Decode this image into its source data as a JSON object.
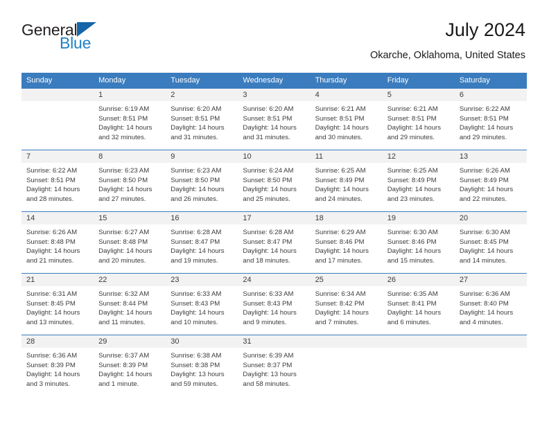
{
  "brand": {
    "name_part1": "General",
    "name_part2": "Blue",
    "triangle_color": "#1565a8",
    "blue_color": "#2081c6"
  },
  "header": {
    "title": "July 2024",
    "location": "Okarche, Oklahoma, United States"
  },
  "theme": {
    "header_row_bg": "#3a7cbe",
    "daynum_bg": "#f2f2f2",
    "text_color": "#3b3b3b",
    "page_bg": "#ffffff"
  },
  "weekdays": [
    "Sunday",
    "Monday",
    "Tuesday",
    "Wednesday",
    "Thursday",
    "Friday",
    "Saturday"
  ],
  "labels": {
    "sunrise_prefix": "Sunrise:",
    "sunset_prefix": "Sunset:",
    "daylight_prefix": "Daylight:"
  },
  "weeks": [
    [
      {
        "day": "",
        "sunrise": "",
        "sunset": "",
        "daylight_line1": "",
        "daylight_line2": "",
        "empty": true
      },
      {
        "day": "1",
        "sunrise": "Sunrise: 6:19 AM",
        "sunset": "Sunset: 8:51 PM",
        "daylight_line1": "Daylight: 14 hours",
        "daylight_line2": "and 32 minutes."
      },
      {
        "day": "2",
        "sunrise": "Sunrise: 6:20 AM",
        "sunset": "Sunset: 8:51 PM",
        "daylight_line1": "Daylight: 14 hours",
        "daylight_line2": "and 31 minutes."
      },
      {
        "day": "3",
        "sunrise": "Sunrise: 6:20 AM",
        "sunset": "Sunset: 8:51 PM",
        "daylight_line1": "Daylight: 14 hours",
        "daylight_line2": "and 31 minutes."
      },
      {
        "day": "4",
        "sunrise": "Sunrise: 6:21 AM",
        "sunset": "Sunset: 8:51 PM",
        "daylight_line1": "Daylight: 14 hours",
        "daylight_line2": "and 30 minutes."
      },
      {
        "day": "5",
        "sunrise": "Sunrise: 6:21 AM",
        "sunset": "Sunset: 8:51 PM",
        "daylight_line1": "Daylight: 14 hours",
        "daylight_line2": "and 29 minutes."
      },
      {
        "day": "6",
        "sunrise": "Sunrise: 6:22 AM",
        "sunset": "Sunset: 8:51 PM",
        "daylight_line1": "Daylight: 14 hours",
        "daylight_line2": "and 29 minutes."
      }
    ],
    [
      {
        "day": "7",
        "sunrise": "Sunrise: 6:22 AM",
        "sunset": "Sunset: 8:51 PM",
        "daylight_line1": "Daylight: 14 hours",
        "daylight_line2": "and 28 minutes."
      },
      {
        "day": "8",
        "sunrise": "Sunrise: 6:23 AM",
        "sunset": "Sunset: 8:50 PM",
        "daylight_line1": "Daylight: 14 hours",
        "daylight_line2": "and 27 minutes."
      },
      {
        "day": "9",
        "sunrise": "Sunrise: 6:23 AM",
        "sunset": "Sunset: 8:50 PM",
        "daylight_line1": "Daylight: 14 hours",
        "daylight_line2": "and 26 minutes."
      },
      {
        "day": "10",
        "sunrise": "Sunrise: 6:24 AM",
        "sunset": "Sunset: 8:50 PM",
        "daylight_line1": "Daylight: 14 hours",
        "daylight_line2": "and 25 minutes."
      },
      {
        "day": "11",
        "sunrise": "Sunrise: 6:25 AM",
        "sunset": "Sunset: 8:49 PM",
        "daylight_line1": "Daylight: 14 hours",
        "daylight_line2": "and 24 minutes."
      },
      {
        "day": "12",
        "sunrise": "Sunrise: 6:25 AM",
        "sunset": "Sunset: 8:49 PM",
        "daylight_line1": "Daylight: 14 hours",
        "daylight_line2": "and 23 minutes."
      },
      {
        "day": "13",
        "sunrise": "Sunrise: 6:26 AM",
        "sunset": "Sunset: 8:49 PM",
        "daylight_line1": "Daylight: 14 hours",
        "daylight_line2": "and 22 minutes."
      }
    ],
    [
      {
        "day": "14",
        "sunrise": "Sunrise: 6:26 AM",
        "sunset": "Sunset: 8:48 PM",
        "daylight_line1": "Daylight: 14 hours",
        "daylight_line2": "and 21 minutes."
      },
      {
        "day": "15",
        "sunrise": "Sunrise: 6:27 AM",
        "sunset": "Sunset: 8:48 PM",
        "daylight_line1": "Daylight: 14 hours",
        "daylight_line2": "and 20 minutes."
      },
      {
        "day": "16",
        "sunrise": "Sunrise: 6:28 AM",
        "sunset": "Sunset: 8:47 PM",
        "daylight_line1": "Daylight: 14 hours",
        "daylight_line2": "and 19 minutes."
      },
      {
        "day": "17",
        "sunrise": "Sunrise: 6:28 AM",
        "sunset": "Sunset: 8:47 PM",
        "daylight_line1": "Daylight: 14 hours",
        "daylight_line2": "and 18 minutes."
      },
      {
        "day": "18",
        "sunrise": "Sunrise: 6:29 AM",
        "sunset": "Sunset: 8:46 PM",
        "daylight_line1": "Daylight: 14 hours",
        "daylight_line2": "and 17 minutes."
      },
      {
        "day": "19",
        "sunrise": "Sunrise: 6:30 AM",
        "sunset": "Sunset: 8:46 PM",
        "daylight_line1": "Daylight: 14 hours",
        "daylight_line2": "and 15 minutes."
      },
      {
        "day": "20",
        "sunrise": "Sunrise: 6:30 AM",
        "sunset": "Sunset: 8:45 PM",
        "daylight_line1": "Daylight: 14 hours",
        "daylight_line2": "and 14 minutes."
      }
    ],
    [
      {
        "day": "21",
        "sunrise": "Sunrise: 6:31 AM",
        "sunset": "Sunset: 8:45 PM",
        "daylight_line1": "Daylight: 14 hours",
        "daylight_line2": "and 13 minutes."
      },
      {
        "day": "22",
        "sunrise": "Sunrise: 6:32 AM",
        "sunset": "Sunset: 8:44 PM",
        "daylight_line1": "Daylight: 14 hours",
        "daylight_line2": "and 11 minutes."
      },
      {
        "day": "23",
        "sunrise": "Sunrise: 6:33 AM",
        "sunset": "Sunset: 8:43 PM",
        "daylight_line1": "Daylight: 14 hours",
        "daylight_line2": "and 10 minutes."
      },
      {
        "day": "24",
        "sunrise": "Sunrise: 6:33 AM",
        "sunset": "Sunset: 8:43 PM",
        "daylight_line1": "Daylight: 14 hours",
        "daylight_line2": "and 9 minutes."
      },
      {
        "day": "25",
        "sunrise": "Sunrise: 6:34 AM",
        "sunset": "Sunset: 8:42 PM",
        "daylight_line1": "Daylight: 14 hours",
        "daylight_line2": "and 7 minutes."
      },
      {
        "day": "26",
        "sunrise": "Sunrise: 6:35 AM",
        "sunset": "Sunset: 8:41 PM",
        "daylight_line1": "Daylight: 14 hours",
        "daylight_line2": "and 6 minutes."
      },
      {
        "day": "27",
        "sunrise": "Sunrise: 6:36 AM",
        "sunset": "Sunset: 8:40 PM",
        "daylight_line1": "Daylight: 14 hours",
        "daylight_line2": "and 4 minutes."
      }
    ],
    [
      {
        "day": "28",
        "sunrise": "Sunrise: 6:36 AM",
        "sunset": "Sunset: 8:39 PM",
        "daylight_line1": "Daylight: 14 hours",
        "daylight_line2": "and 3 minutes."
      },
      {
        "day": "29",
        "sunrise": "Sunrise: 6:37 AM",
        "sunset": "Sunset: 8:39 PM",
        "daylight_line1": "Daylight: 14 hours",
        "daylight_line2": "and 1 minute."
      },
      {
        "day": "30",
        "sunrise": "Sunrise: 6:38 AM",
        "sunset": "Sunset: 8:38 PM",
        "daylight_line1": "Daylight: 13 hours",
        "daylight_line2": "and 59 minutes."
      },
      {
        "day": "31",
        "sunrise": "Sunrise: 6:39 AM",
        "sunset": "Sunset: 8:37 PM",
        "daylight_line1": "Daylight: 13 hours",
        "daylight_line2": "and 58 minutes."
      },
      {
        "day": "",
        "sunrise": "",
        "sunset": "",
        "daylight_line1": "",
        "daylight_line2": "",
        "empty": true
      },
      {
        "day": "",
        "sunrise": "",
        "sunset": "",
        "daylight_line1": "",
        "daylight_line2": "",
        "empty": true
      },
      {
        "day": "",
        "sunrise": "",
        "sunset": "",
        "daylight_line1": "",
        "daylight_line2": "",
        "empty": true
      }
    ]
  ]
}
